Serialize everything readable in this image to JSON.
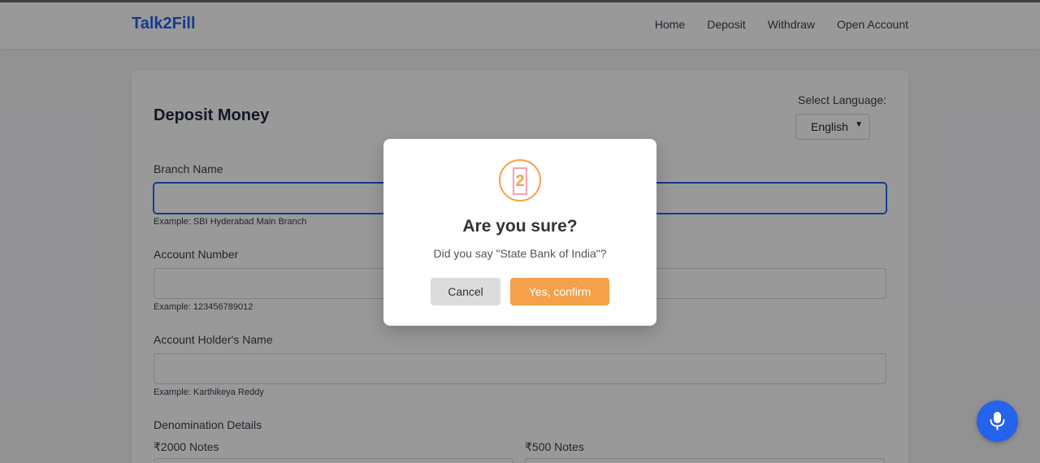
{
  "nav": {
    "brand": "Talk2Fill",
    "links": [
      "Home",
      "Deposit",
      "Withdraw",
      "Open Account"
    ]
  },
  "form": {
    "title": "Deposit Money",
    "language_label": "Select Language:",
    "language_value": "English",
    "fields": [
      {
        "label": "Branch Name",
        "hint": "Example: SBI Hyderabad Main Branch",
        "value": ""
      },
      {
        "label": "Account Number",
        "hint": "Example: 123456789012",
        "value": ""
      },
      {
        "label": "Account Holder's Name",
        "hint": "Example: Karthikeya Reddy",
        "value": ""
      }
    ],
    "denomination_label": "Denomination Details",
    "notes_2000_label": "₹2000 Notes",
    "notes_500_label": "₹500 Notes"
  },
  "dialog": {
    "icon_char": "2",
    "title": "Are you sure?",
    "message": "Did you say \"State Bank of India\"?",
    "cancel_label": "Cancel",
    "confirm_label": "Yes, confirm"
  },
  "colors": {
    "brand": "#2563eb",
    "confirm": "#f5a04a",
    "mic": "#2563eb"
  },
  "icons": {
    "mic": "microphone-icon"
  }
}
